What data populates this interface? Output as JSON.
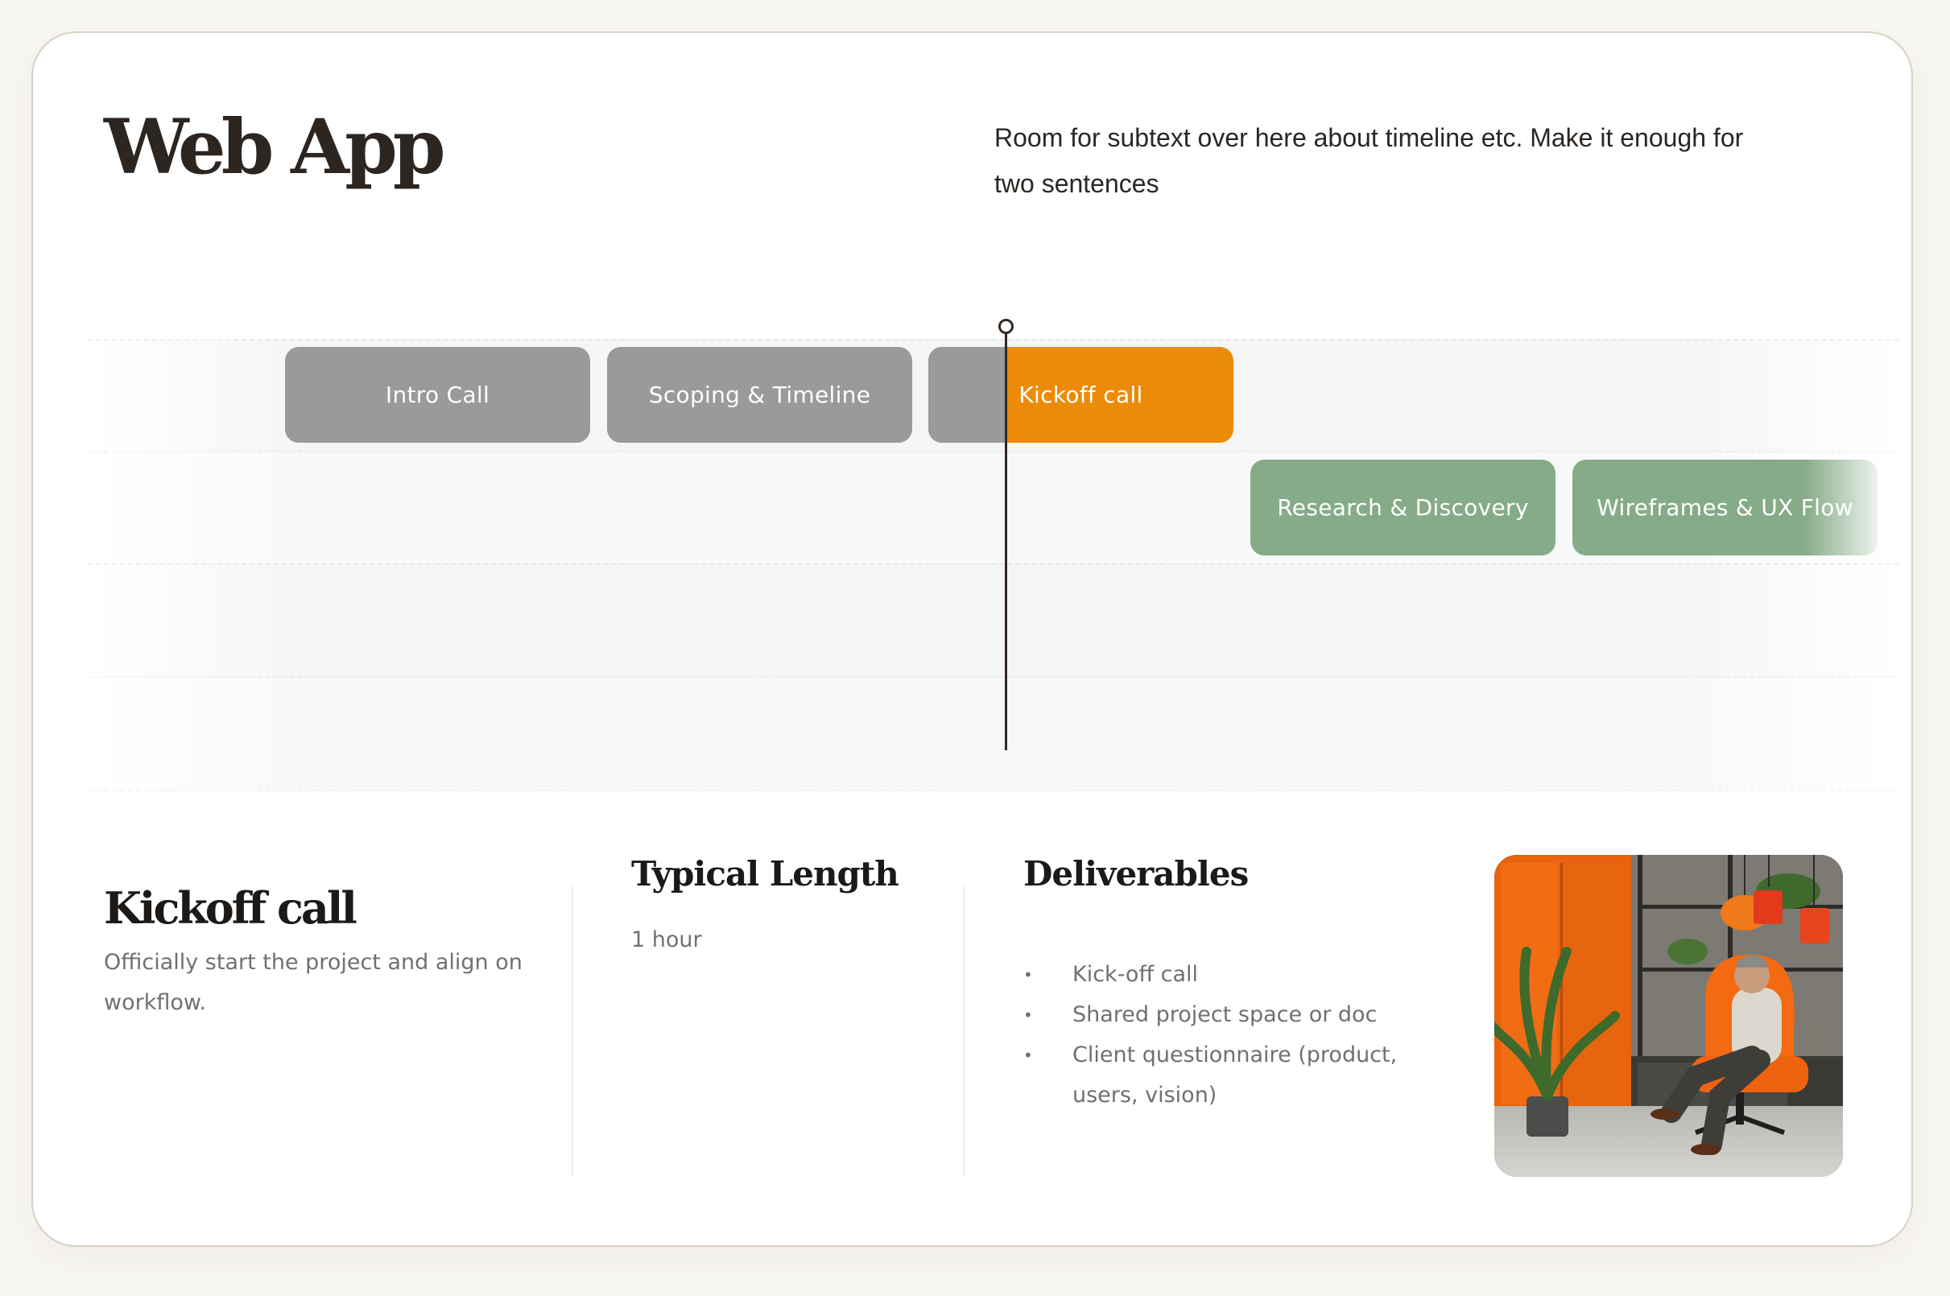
{
  "header": {
    "title": "Web App",
    "subtext": "Room for subtext over here about timeline etc. Make it enough for two sentences"
  },
  "timeline": {
    "phases": [
      {
        "label": "Intro Call",
        "state": "complete"
      },
      {
        "label": "Scoping & Timeline",
        "state": "complete"
      },
      {
        "label": "Kickoff call",
        "state": "current"
      },
      {
        "label": "Research & Discovery",
        "state": "upcoming"
      },
      {
        "label": "Wireframes & UX Flow",
        "state": "upcoming"
      }
    ],
    "colors": {
      "complete": "#9a9a9a",
      "current": "#ec8b07",
      "upcoming": "#86ab88"
    }
  },
  "detail": {
    "title": "Kickoff call",
    "description": "Officially start the project and align on workflow.",
    "length_heading": "Typical Length",
    "length_value": "1 hour",
    "deliverables_heading": "Deliverables",
    "deliverables": [
      "Kick-off call",
      "Shared project space or doc",
      "Client questionnaire (product, users, vision)"
    ]
  },
  "photo": {
    "subject": "man-in-orange-armchair-photo"
  }
}
